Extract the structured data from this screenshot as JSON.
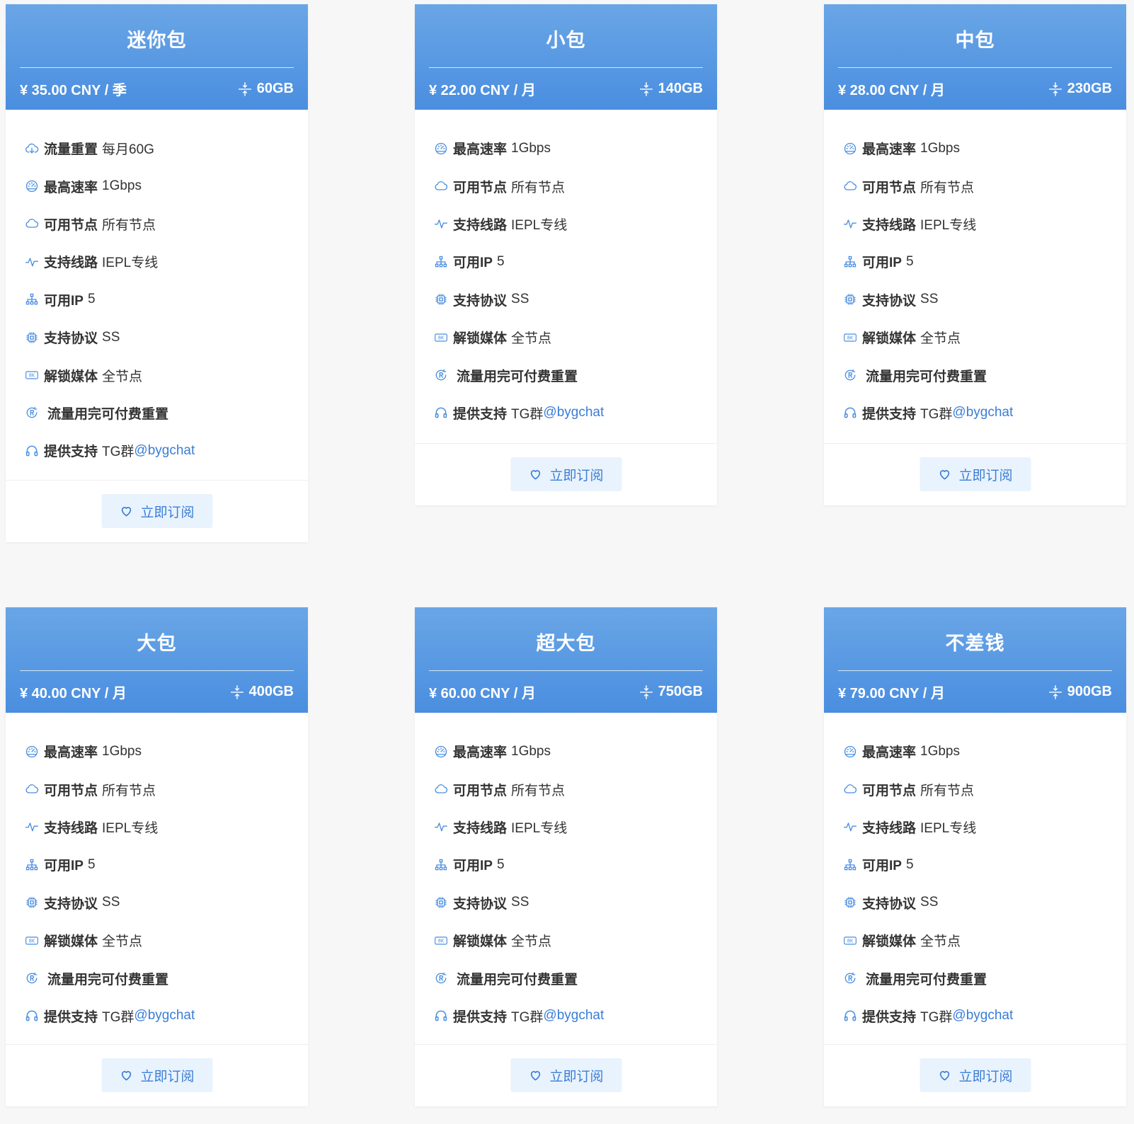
{
  "colors": {
    "header_gradient_top": "#6aa6e6",
    "header_gradient_bottom": "#4a8ee0",
    "accent": "#3a7dd6",
    "button_bg": "#e9f3fd"
  },
  "plans": [
    {
      "name": "迷你包",
      "price": "¥ 35.00 CNY / 季",
      "data": "60GB",
      "button": "立即订阅",
      "features": [
        {
          "icon": "cloud-download-icon",
          "label": "流量重置",
          "value": "每月60G"
        },
        {
          "icon": "dashboard-icon",
          "label": "最高速率",
          "value": "1Gbps"
        },
        {
          "icon": "cloud-icon",
          "label": "可用节点",
          "value": "所有节点"
        },
        {
          "icon": "pulse-icon",
          "label": "支持线路",
          "value": "IEPL专线"
        },
        {
          "icon": "network-icon",
          "label": "可用IP",
          "value": "5"
        },
        {
          "icon": "chip-icon",
          "label": "支持协议",
          "value": "SS"
        },
        {
          "icon": "8k-icon",
          "label": "解锁媒体",
          "value": "全节点"
        },
        {
          "icon": "reset-icon",
          "label": "流量用完可付费重置",
          "value": ""
        },
        {
          "icon": "headset-icon",
          "label": "提供支持",
          "value": "TG群",
          "link": "@bygchat"
        }
      ]
    },
    {
      "name": "小包",
      "price": "¥ 22.00 CNY / 月",
      "data": "140GB",
      "button": "立即订阅",
      "features": [
        {
          "icon": "dashboard-icon",
          "label": "最高速率",
          "value": "1Gbps"
        },
        {
          "icon": "cloud-icon",
          "label": "可用节点",
          "value": "所有节点"
        },
        {
          "icon": "pulse-icon",
          "label": "支持线路",
          "value": "IEPL专线"
        },
        {
          "icon": "network-icon",
          "label": "可用IP",
          "value": "5"
        },
        {
          "icon": "chip-icon",
          "label": "支持协议",
          "value": "SS"
        },
        {
          "icon": "8k-icon",
          "label": "解锁媒体",
          "value": "全节点"
        },
        {
          "icon": "reset-icon",
          "label": "流量用完可付费重置",
          "value": ""
        },
        {
          "icon": "headset-icon",
          "label": "提供支持",
          "value": "TG群",
          "link": "@bygchat"
        }
      ]
    },
    {
      "name": "中包",
      "price": "¥ 28.00 CNY / 月",
      "data": "230GB",
      "button": "立即订阅",
      "features": [
        {
          "icon": "dashboard-icon",
          "label": "最高速率",
          "value": "1Gbps"
        },
        {
          "icon": "cloud-icon",
          "label": "可用节点",
          "value": "所有节点"
        },
        {
          "icon": "pulse-icon",
          "label": "支持线路",
          "value": "IEPL专线"
        },
        {
          "icon": "network-icon",
          "label": "可用IP",
          "value": "5"
        },
        {
          "icon": "chip-icon",
          "label": "支持协议",
          "value": "SS"
        },
        {
          "icon": "8k-icon",
          "label": "解锁媒体",
          "value": "全节点"
        },
        {
          "icon": "reset-icon",
          "label": "流量用完可付费重置",
          "value": ""
        },
        {
          "icon": "headset-icon",
          "label": "提供支持",
          "value": "TG群",
          "link": "@bygchat"
        }
      ]
    },
    {
      "name": "大包",
      "price": "¥ 40.00 CNY / 月",
      "data": "400GB",
      "button": "立即订阅",
      "features": [
        {
          "icon": "dashboard-icon",
          "label": "最高速率",
          "value": "1Gbps"
        },
        {
          "icon": "cloud-icon",
          "label": "可用节点",
          "value": "所有节点"
        },
        {
          "icon": "pulse-icon",
          "label": "支持线路",
          "value": "IEPL专线"
        },
        {
          "icon": "network-icon",
          "label": "可用IP",
          "value": "5"
        },
        {
          "icon": "chip-icon",
          "label": "支持协议",
          "value": "SS"
        },
        {
          "icon": "8k-icon",
          "label": "解锁媒体",
          "value": "全节点"
        },
        {
          "icon": "reset-icon",
          "label": "流量用完可付费重置",
          "value": ""
        },
        {
          "icon": "headset-icon",
          "label": "提供支持",
          "value": "TG群",
          "link": "@bygchat"
        }
      ]
    },
    {
      "name": "超大包",
      "price": "¥ 60.00 CNY / 月",
      "data": "750GB",
      "button": "立即订阅",
      "features": [
        {
          "icon": "dashboard-icon",
          "label": "最高速率",
          "value": "1Gbps"
        },
        {
          "icon": "cloud-icon",
          "label": "可用节点",
          "value": "所有节点"
        },
        {
          "icon": "pulse-icon",
          "label": "支持线路",
          "value": "IEPL专线"
        },
        {
          "icon": "network-icon",
          "label": "可用IP",
          "value": "5"
        },
        {
          "icon": "chip-icon",
          "label": "支持协议",
          "value": "SS"
        },
        {
          "icon": "8k-icon",
          "label": "解锁媒体",
          "value": "全节点"
        },
        {
          "icon": "reset-icon",
          "label": "流量用完可付费重置",
          "value": ""
        },
        {
          "icon": "headset-icon",
          "label": "提供支持",
          "value": "TG群",
          "link": "@bygchat"
        }
      ]
    },
    {
      "name": "不差钱",
      "price": "¥ 79.00 CNY / 月",
      "data": "900GB",
      "button": "立即订阅",
      "features": [
        {
          "icon": "dashboard-icon",
          "label": "最高速率",
          "value": "1Gbps"
        },
        {
          "icon": "cloud-icon",
          "label": "可用节点",
          "value": "所有节点"
        },
        {
          "icon": "pulse-icon",
          "label": "支持线路",
          "value": "IEPL专线"
        },
        {
          "icon": "network-icon",
          "label": "可用IP",
          "value": "5"
        },
        {
          "icon": "chip-icon",
          "label": "支持协议",
          "value": "SS"
        },
        {
          "icon": "8k-icon",
          "label": "解锁媒体",
          "value": "全节点"
        },
        {
          "icon": "reset-icon",
          "label": "流量用完可付费重置",
          "value": ""
        },
        {
          "icon": "headset-icon",
          "label": "提供支持",
          "value": "TG群",
          "link": "@bygchat"
        }
      ]
    }
  ]
}
